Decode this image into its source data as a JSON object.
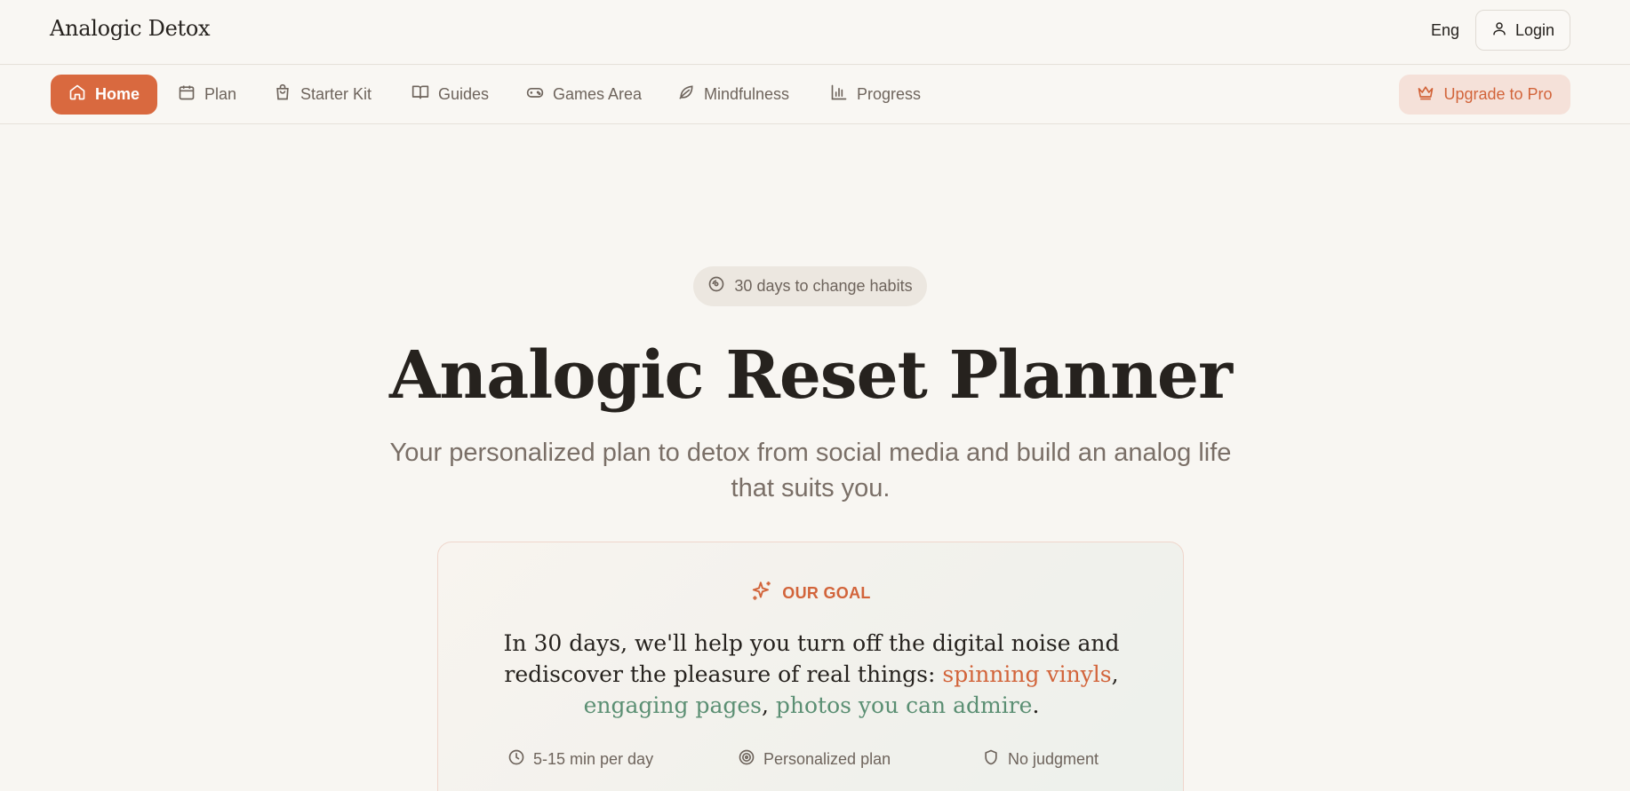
{
  "header": {
    "brand": "Analogic Detox",
    "language": "Eng",
    "login_label": "Login"
  },
  "nav": {
    "items": [
      {
        "label": "Home",
        "icon": "home-icon",
        "active": true
      },
      {
        "label": "Plan",
        "icon": "calendar-icon"
      },
      {
        "label": "Starter Kit",
        "icon": "shopping-bag-icon"
      },
      {
        "label": "Guides",
        "icon": "book-open-icon"
      },
      {
        "label": "Games Area",
        "icon": "gamepad-icon"
      },
      {
        "label": "Mindfulness",
        "icon": "leaf-icon"
      },
      {
        "label": "Progress",
        "icon": "bar-chart-icon"
      }
    ],
    "upgrade_label": "Upgrade to Pro"
  },
  "hero": {
    "badge": "30 days to change habits",
    "title": "Analogic Reset Planner",
    "subtitle": "Your personalized plan to detox from social media and build an analog life that suits you."
  },
  "goal": {
    "heading": "OUR GOAL",
    "text_before": "In 30 days, we'll help you turn off the digital noise and rediscover the pleasure of real things: ",
    "highlight_1": "spinning vinyls",
    "sep_1": ", ",
    "highlight_2": "engaging pages",
    "sep_2": ", ",
    "highlight_3": "photos you can admire",
    "text_after": ".",
    "features": [
      {
        "label": "5-15 min per day",
        "icon": "clock-icon"
      },
      {
        "label": "Personalized plan",
        "icon": "target-icon"
      },
      {
        "label": "No judgment",
        "icon": "shield-icon"
      }
    ]
  },
  "colors": {
    "accent": "#d9693f",
    "accent_text": "#d2643a",
    "green": "#5b8f73",
    "background": "#f8f6f2"
  }
}
